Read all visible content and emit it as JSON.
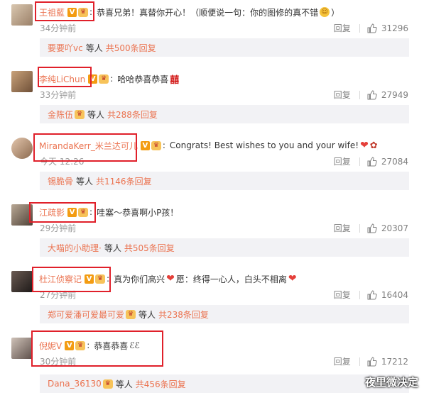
{
  "comments": [
    {
      "user": "王祖藍",
      "text": "恭喜兄弟！真替你开心！（顺便说一句：你的图修的真不错",
      "text_end": "）",
      "time": "34分钟前",
      "reply_label": "回复",
      "likes": "31296",
      "reply_bar": {
        "users": "要要吖vc",
        "mid": "等人",
        "count": "共500条回复"
      }
    },
    {
      "user": "李纯LiChun",
      "text": "哈哈恭喜恭喜",
      "text_end": "",
      "time": "33分钟前",
      "reply_label": "回复",
      "likes": "27949",
      "reply_bar": {
        "users": "金陈伍",
        "mid": "等人",
        "count": "共288条回复"
      }
    },
    {
      "user": "MirandaKerr_米兰达可儿",
      "text": "Congrats!  Best wishes to you and your wife!",
      "text_end": "",
      "time": "今天 12:26",
      "reply_label": "回复",
      "likes": "27084",
      "reply_bar": {
        "users": "锡脆骨",
        "mid": "等人",
        "count": "共1146条回复"
      }
    },
    {
      "user": "江疏影",
      "text": "哇塞～恭喜啊小P孩！",
      "text_end": "",
      "time": "29分钟前",
      "reply_label": "回复",
      "likes": "20307",
      "reply_bar": {
        "users": "大喵的小助理·",
        "mid": "等人",
        "count": "共505条回复"
      }
    },
    {
      "user": "杜江侦察记",
      "text": "真为你们高兴",
      "text_mid": "愿：终得一心人，白头不相离",
      "text_end": "",
      "time": "27分钟前",
      "reply_label": "回复",
      "likes": "16404",
      "reply_bar": {
        "users": "郑可爱潘可爱最可爱",
        "mid": "等人",
        "count": "共238条回复"
      }
    },
    {
      "user": "倪妮V",
      "text": "恭喜恭喜",
      "text_end": "",
      "time": "30分钟前",
      "reply_label": "回复",
      "likes": "17212",
      "reply_bar": {
        "users": "Dana_36130",
        "mid": "等人",
        "count": "共456条回复"
      }
    }
  ],
  "badge_v": "V",
  "watermark": "夜里微决定"
}
